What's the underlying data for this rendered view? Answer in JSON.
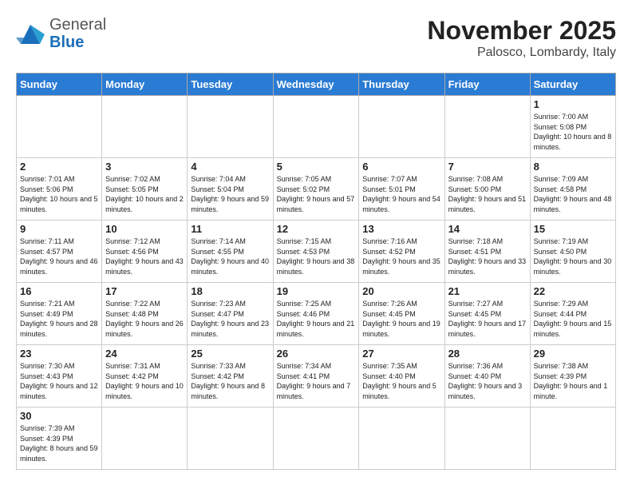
{
  "header": {
    "logo": {
      "general": "General",
      "blue": "Blue"
    },
    "title": "November 2025",
    "location": "Palosco, Lombardy, Italy"
  },
  "days_of_week": [
    "Sunday",
    "Monday",
    "Tuesday",
    "Wednesday",
    "Thursday",
    "Friday",
    "Saturday"
  ],
  "weeks": [
    [
      {
        "day": "",
        "info": ""
      },
      {
        "day": "",
        "info": ""
      },
      {
        "day": "",
        "info": ""
      },
      {
        "day": "",
        "info": ""
      },
      {
        "day": "",
        "info": ""
      },
      {
        "day": "",
        "info": ""
      },
      {
        "day": "1",
        "info": "Sunrise: 7:00 AM\nSunset: 5:08 PM\nDaylight: 10 hours\nand 8 minutes."
      }
    ],
    [
      {
        "day": "2",
        "info": "Sunrise: 7:01 AM\nSunset: 5:06 PM\nDaylight: 10 hours\nand 5 minutes."
      },
      {
        "day": "3",
        "info": "Sunrise: 7:02 AM\nSunset: 5:05 PM\nDaylight: 10 hours\nand 2 minutes."
      },
      {
        "day": "4",
        "info": "Sunrise: 7:04 AM\nSunset: 5:04 PM\nDaylight: 9 hours\nand 59 minutes."
      },
      {
        "day": "5",
        "info": "Sunrise: 7:05 AM\nSunset: 5:02 PM\nDaylight: 9 hours\nand 57 minutes."
      },
      {
        "day": "6",
        "info": "Sunrise: 7:07 AM\nSunset: 5:01 PM\nDaylight: 9 hours\nand 54 minutes."
      },
      {
        "day": "7",
        "info": "Sunrise: 7:08 AM\nSunset: 5:00 PM\nDaylight: 9 hours\nand 51 minutes."
      },
      {
        "day": "8",
        "info": "Sunrise: 7:09 AM\nSunset: 4:58 PM\nDaylight: 9 hours\nand 48 minutes."
      }
    ],
    [
      {
        "day": "9",
        "info": "Sunrise: 7:11 AM\nSunset: 4:57 PM\nDaylight: 9 hours\nand 46 minutes."
      },
      {
        "day": "10",
        "info": "Sunrise: 7:12 AM\nSunset: 4:56 PM\nDaylight: 9 hours\nand 43 minutes."
      },
      {
        "day": "11",
        "info": "Sunrise: 7:14 AM\nSunset: 4:55 PM\nDaylight: 9 hours\nand 40 minutes."
      },
      {
        "day": "12",
        "info": "Sunrise: 7:15 AM\nSunset: 4:53 PM\nDaylight: 9 hours\nand 38 minutes."
      },
      {
        "day": "13",
        "info": "Sunrise: 7:16 AM\nSunset: 4:52 PM\nDaylight: 9 hours\nand 35 minutes."
      },
      {
        "day": "14",
        "info": "Sunrise: 7:18 AM\nSunset: 4:51 PM\nDaylight: 9 hours\nand 33 minutes."
      },
      {
        "day": "15",
        "info": "Sunrise: 7:19 AM\nSunset: 4:50 PM\nDaylight: 9 hours\nand 30 minutes."
      }
    ],
    [
      {
        "day": "16",
        "info": "Sunrise: 7:21 AM\nSunset: 4:49 PM\nDaylight: 9 hours\nand 28 minutes."
      },
      {
        "day": "17",
        "info": "Sunrise: 7:22 AM\nSunset: 4:48 PM\nDaylight: 9 hours\nand 26 minutes."
      },
      {
        "day": "18",
        "info": "Sunrise: 7:23 AM\nSunset: 4:47 PM\nDaylight: 9 hours\nand 23 minutes."
      },
      {
        "day": "19",
        "info": "Sunrise: 7:25 AM\nSunset: 4:46 PM\nDaylight: 9 hours\nand 21 minutes."
      },
      {
        "day": "20",
        "info": "Sunrise: 7:26 AM\nSunset: 4:45 PM\nDaylight: 9 hours\nand 19 minutes."
      },
      {
        "day": "21",
        "info": "Sunrise: 7:27 AM\nSunset: 4:45 PM\nDaylight: 9 hours\nand 17 minutes."
      },
      {
        "day": "22",
        "info": "Sunrise: 7:29 AM\nSunset: 4:44 PM\nDaylight: 9 hours\nand 15 minutes."
      }
    ],
    [
      {
        "day": "23",
        "info": "Sunrise: 7:30 AM\nSunset: 4:43 PM\nDaylight: 9 hours\nand 12 minutes."
      },
      {
        "day": "24",
        "info": "Sunrise: 7:31 AM\nSunset: 4:42 PM\nDaylight: 9 hours\nand 10 minutes."
      },
      {
        "day": "25",
        "info": "Sunrise: 7:33 AM\nSunset: 4:42 PM\nDaylight: 9 hours\nand 8 minutes."
      },
      {
        "day": "26",
        "info": "Sunrise: 7:34 AM\nSunset: 4:41 PM\nDaylight: 9 hours\nand 7 minutes."
      },
      {
        "day": "27",
        "info": "Sunrise: 7:35 AM\nSunset: 4:40 PM\nDaylight: 9 hours\nand 5 minutes."
      },
      {
        "day": "28",
        "info": "Sunrise: 7:36 AM\nSunset: 4:40 PM\nDaylight: 9 hours\nand 3 minutes."
      },
      {
        "day": "29",
        "info": "Sunrise: 7:38 AM\nSunset: 4:39 PM\nDaylight: 9 hours\nand 1 minute."
      }
    ],
    [
      {
        "day": "30",
        "info": "Sunrise: 7:39 AM\nSunset: 4:39 PM\nDaylight: 8 hours\nand 59 minutes."
      },
      {
        "day": "",
        "info": ""
      },
      {
        "day": "",
        "info": ""
      },
      {
        "day": "",
        "info": ""
      },
      {
        "day": "",
        "info": ""
      },
      {
        "day": "",
        "info": ""
      },
      {
        "day": "",
        "info": ""
      }
    ]
  ]
}
